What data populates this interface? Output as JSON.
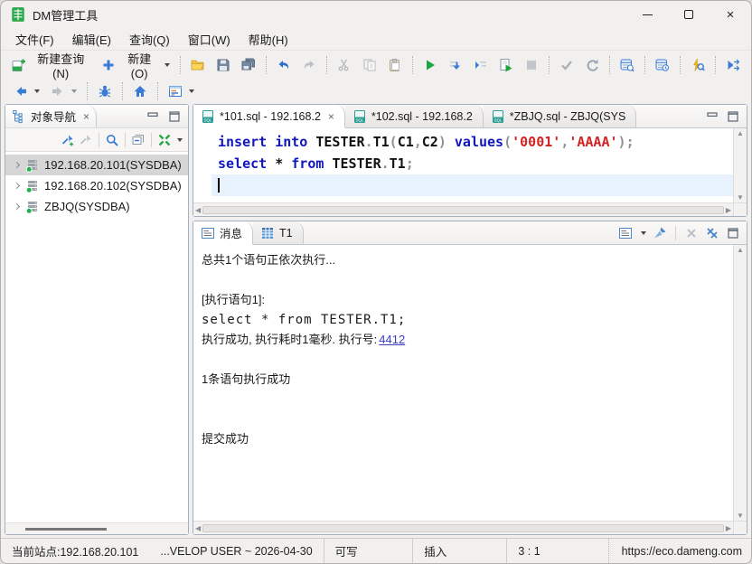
{
  "window": {
    "title": "DM管理工具"
  },
  "menu": {
    "items": [
      "文件(F)",
      "编辑(E)",
      "查询(Q)",
      "窗口(W)",
      "帮助(H)"
    ]
  },
  "toolbar": {
    "new_query_label": "新建查询(N)",
    "new_label": "新建(O)"
  },
  "navigator": {
    "title": "对象导航",
    "items": [
      {
        "label": "192.168.20.101(SYSDBA)",
        "selected": true
      },
      {
        "label": "192.168.20.102(SYSDBA)",
        "selected": false
      },
      {
        "label": "ZBJQ(SYSDBA)",
        "selected": false
      }
    ]
  },
  "editor": {
    "tabs": [
      {
        "label": "*101.sql - 192.168.2",
        "active": true,
        "closable": true
      },
      {
        "label": "*102.sql - 192.168.2",
        "active": false,
        "closable": false
      },
      {
        "label": "*ZBJQ.sql - ZBJQ(SYS",
        "active": false,
        "closable": false
      }
    ],
    "code_lines": [
      {
        "tokens": [
          [
            "kw",
            "insert"
          ],
          [
            "pl",
            " "
          ],
          [
            "kw",
            "into"
          ],
          [
            "pl",
            " "
          ],
          [
            "id",
            "TESTER"
          ],
          [
            "pu",
            "."
          ],
          [
            "id",
            "T1"
          ],
          [
            "pu",
            "("
          ],
          [
            "id",
            "C1"
          ],
          [
            "pu",
            ","
          ],
          [
            "id",
            "C2"
          ],
          [
            "pu",
            ")"
          ],
          [
            "pl",
            " "
          ],
          [
            "kw",
            "values"
          ],
          [
            "pu",
            "("
          ],
          [
            "st",
            "'0001'"
          ],
          [
            "pu",
            ","
          ],
          [
            "st",
            "'AAAA'"
          ],
          [
            "pu",
            ")"
          ],
          [
            "pu",
            ";"
          ]
        ]
      },
      {
        "tokens": [
          [
            "kw",
            "select"
          ],
          [
            "pl",
            " "
          ],
          [
            "id",
            "*"
          ],
          [
            "pl",
            " "
          ],
          [
            "kw",
            "from"
          ],
          [
            "pl",
            " "
          ],
          [
            "id",
            "TESTER"
          ],
          [
            "pu",
            "."
          ],
          [
            "id",
            "T1"
          ],
          [
            "pu",
            ";"
          ]
        ]
      }
    ]
  },
  "output": {
    "tabs": [
      {
        "label": "消息",
        "icon": "message",
        "active": true
      },
      {
        "label": "T1",
        "icon": "table",
        "active": false
      }
    ],
    "lines": [
      {
        "text": "总共1个语句正依次执行..."
      },
      {
        "text": ""
      },
      {
        "text": "[执行语句1]:"
      },
      {
        "text": "select * from TESTER.T1;",
        "mono": true
      },
      {
        "text": "执行成功, 执行耗时1毫秒. 执行号:",
        "link": "4412"
      },
      {
        "text": ""
      },
      {
        "text": "1条语句执行成功"
      },
      {
        "text": ""
      },
      {
        "text": ""
      },
      {
        "text": "提交成功"
      }
    ]
  },
  "statusbar": {
    "site": "当前站点:192.168.20.101",
    "session": "...VELOP USER ~ 2026-04-30",
    "write_mode": "可写",
    "input_mode": "插入",
    "caret_position": "3 : 1",
    "url": "https://eco.dameng.com"
  }
}
